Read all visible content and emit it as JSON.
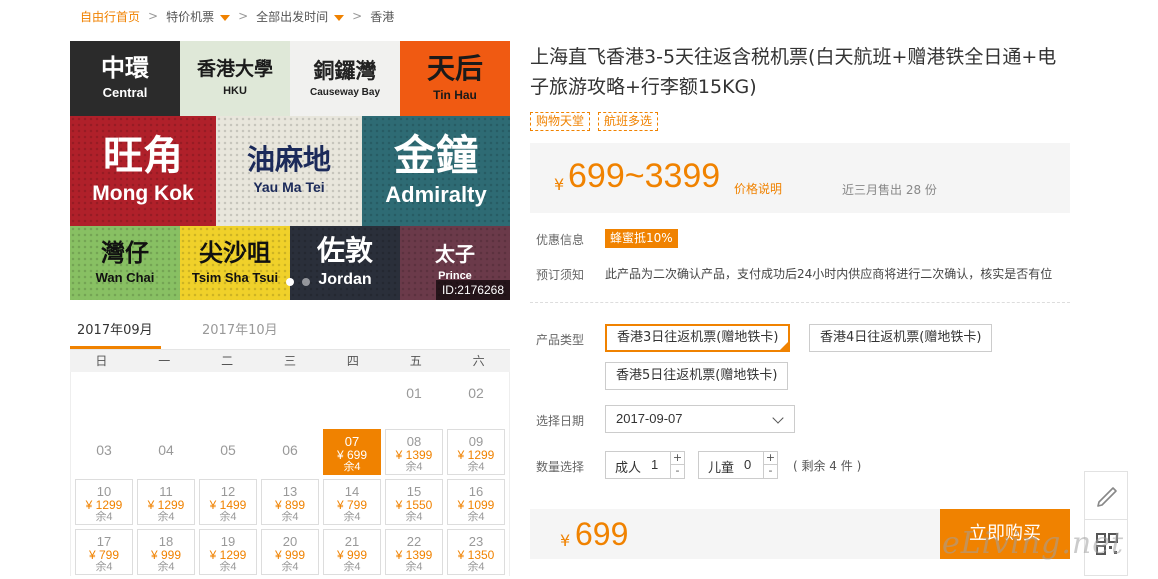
{
  "breadcrumb": {
    "home": "自由行首页",
    "sep": ">",
    "category": "特价机票",
    "departure": "全部出发时间",
    "destination": "香港"
  },
  "hero": {
    "image_id": "ID:2176268",
    "tiles": [
      {
        "zh": "中環",
        "en": "Central",
        "bg": "#2b2b2b",
        "fg": "#ffffff"
      },
      {
        "zh": "香港大學",
        "en": "HKU",
        "bg": "#dfe8d8",
        "fg": "#1b1b1b"
      },
      {
        "zh": "銅鑼灣",
        "en": "Causeway Bay",
        "bg": "#f1f1ef",
        "fg": "#222222"
      },
      {
        "zh": "天后",
        "en": "Tin Hau",
        "bg": "#f05a12",
        "fg": "#1a1a1a"
      },
      {
        "zh": "旺角",
        "en": "Mong Kok",
        "bg": "#b0202a",
        "fg": "#ffffff"
      },
      {
        "zh": "油麻地",
        "en": "Yau Ma Tei",
        "bg": "#e8e6dc",
        "fg": "#1b2a5a"
      },
      {
        "zh": "金鐘",
        "en": "Admiralty",
        "bg": "#2e6b74",
        "fg": "#ffffff"
      },
      {
        "zh": "灣仔",
        "en": "Wan Chai",
        "bg": "#88c063",
        "fg": "#111111"
      },
      {
        "zh": "尖沙咀",
        "en": "Tsim Sha Tsui",
        "bg": "#f0d12a",
        "fg": "#111111"
      },
      {
        "zh": "佐敦",
        "en": "Jordan",
        "bg": "#2a2f3a",
        "fg": "#ffffff"
      },
      {
        "zh": "太子",
        "en": "Prince",
        "bg": "#6b3a4a",
        "fg": "#ffffff"
      }
    ]
  },
  "calendar": {
    "tabs": [
      "2017年09月",
      "2017年10月"
    ],
    "weekdays": [
      "日",
      "一",
      "二",
      "三",
      "四",
      "五",
      "六"
    ],
    "plain_days": [
      "01",
      "02",
      "03",
      "04",
      "05",
      "06"
    ],
    "days": [
      {
        "d": "07",
        "p": "¥ 699",
        "r": "余4",
        "selected": true
      },
      {
        "d": "08",
        "p": "¥ 1399",
        "r": "余4"
      },
      {
        "d": "09",
        "p": "¥ 1299",
        "r": "余4"
      },
      {
        "d": "10",
        "p": "¥ 1299",
        "r": "余4"
      },
      {
        "d": "11",
        "p": "¥ 1299",
        "r": "余4"
      },
      {
        "d": "12",
        "p": "¥ 1499",
        "r": "余4"
      },
      {
        "d": "13",
        "p": "¥ 899",
        "r": "余4"
      },
      {
        "d": "14",
        "p": "¥ 799",
        "r": "余4"
      },
      {
        "d": "15",
        "p": "¥ 1550",
        "r": "余4"
      },
      {
        "d": "16",
        "p": "¥ 1099",
        "r": "余4"
      },
      {
        "d": "17",
        "p": "¥ 799",
        "r": "余4"
      },
      {
        "d": "18",
        "p": "¥ 999",
        "r": "余4"
      },
      {
        "d": "19",
        "p": "¥ 1299",
        "r": "余4"
      },
      {
        "d": "20",
        "p": "¥ 999",
        "r": "余4"
      },
      {
        "d": "21",
        "p": "¥ 999",
        "r": "余4"
      },
      {
        "d": "22",
        "p": "¥ 1399",
        "r": "余4"
      },
      {
        "d": "23",
        "p": "¥ 1350",
        "r": "余4"
      }
    ]
  },
  "product": {
    "title": "上海直飞香港3-5天往返含税机票(白天航班+赠港铁全日通+电子旅游攻略+行李额15KG)",
    "tags": [
      "购物天堂",
      "航班多选"
    ],
    "price_yen": "¥",
    "price_range": "699~3399",
    "price_explain": "价格说明",
    "sold": "近三月售出 28 份",
    "discount_label": "优惠信息",
    "discount": "蜂蜜抵10%",
    "notice_label": "预订须知",
    "notice": "此产品为二次确认产品，支付成功后24小时内供应商将进行二次确认，核实是否有位",
    "type_label": "产品类型",
    "types": [
      "香港3日往返机票(赠地铁卡)",
      "香港4日往返机票(赠地铁卡)",
      "香港5日往返机票(赠地铁卡)"
    ],
    "date_label": "选择日期",
    "date_value": "2017-09-07",
    "qty_label": "数量选择",
    "adult_label": "成人",
    "adult_value": "1",
    "child_label": "儿童",
    "child_value": "0",
    "plus": "+",
    "minus": "-",
    "remain": "( 剩余 4 件 )",
    "total_yen": "¥",
    "total": "699",
    "buy": "立即购买"
  },
  "watermark": "eLiving.net",
  "colors": {
    "accent": "#f08200",
    "panel": "#f5f5f5"
  }
}
